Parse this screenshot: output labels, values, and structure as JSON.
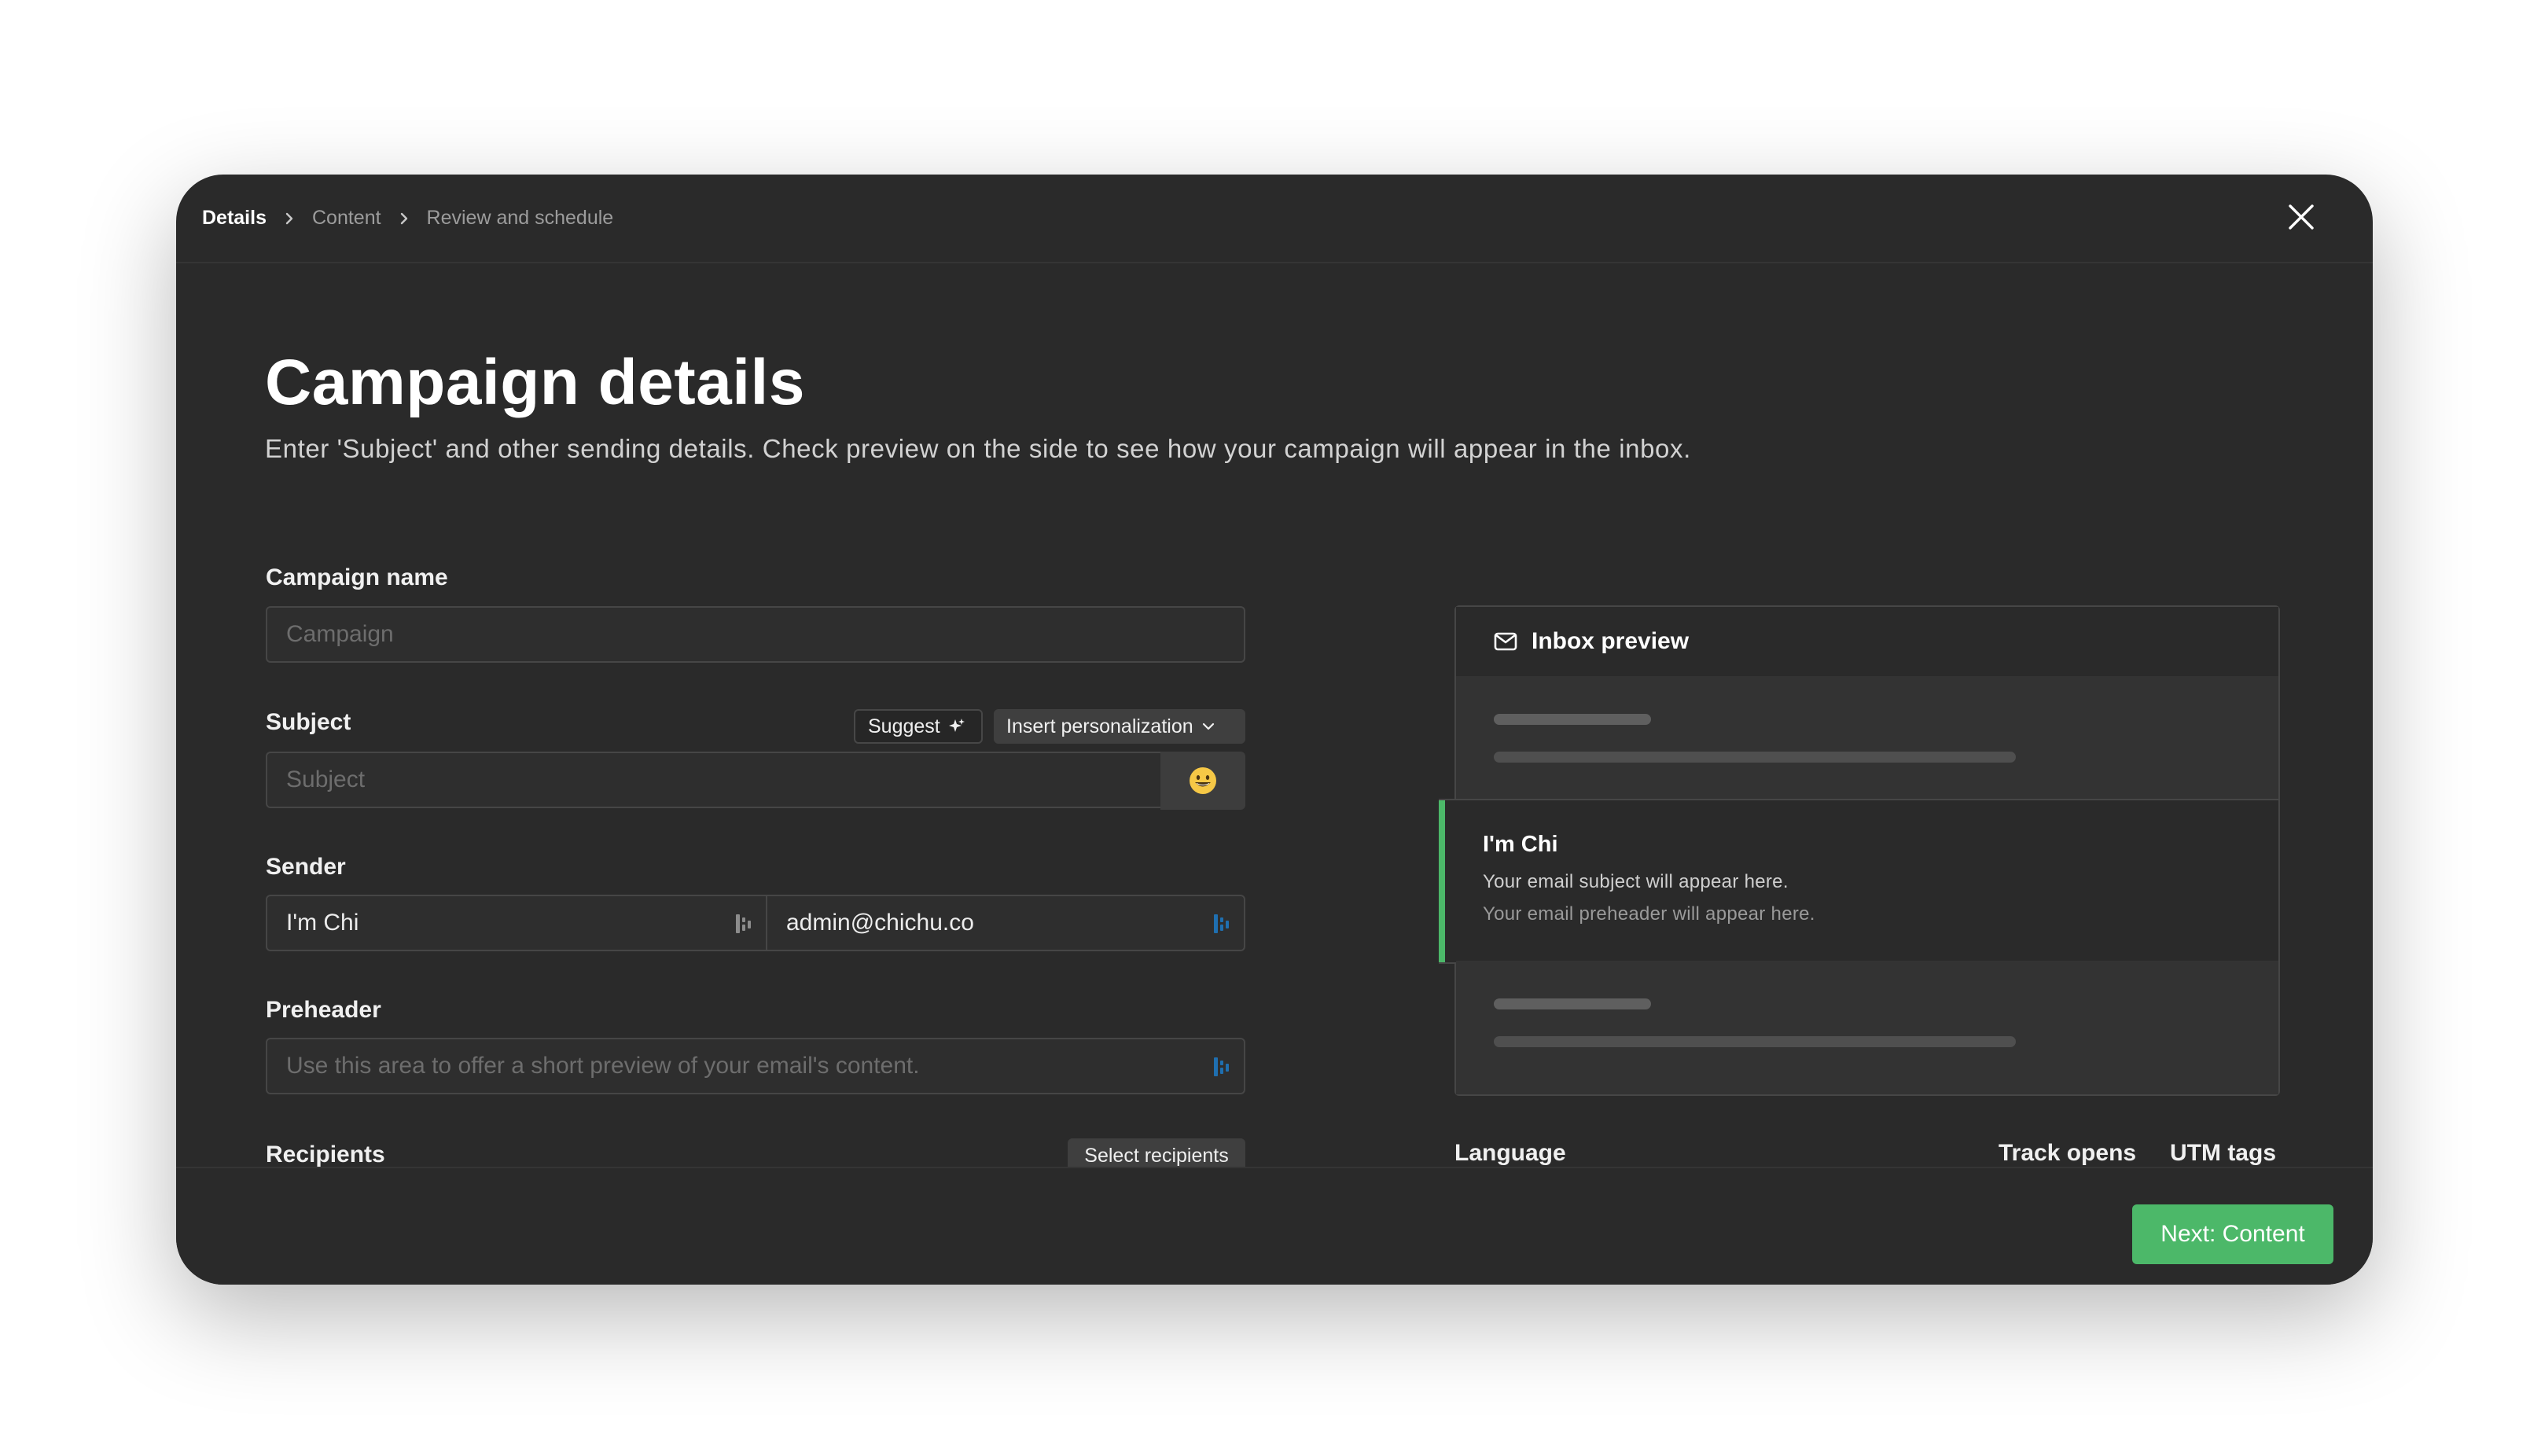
{
  "breadcrumb": {
    "items": [
      "Details",
      "Content",
      "Review and schedule"
    ]
  },
  "header": {
    "title": "Campaign details",
    "subtitle": "Enter 'Subject' and other sending details. Check preview on the side to see how your campaign will appear in the inbox."
  },
  "form": {
    "campaign_name": {
      "label": "Campaign name",
      "placeholder": "Campaign",
      "value": ""
    },
    "subject": {
      "label": "Subject",
      "placeholder": "Subject",
      "value": "",
      "suggest_label": "Suggest",
      "personalization_label": "Insert personalization",
      "emoji": "😀"
    },
    "sender": {
      "label": "Sender",
      "name": "I'm Chi",
      "email": "admin@chichu.co"
    },
    "preheader": {
      "label": "Preheader",
      "placeholder": "Use this area to offer a short preview of your email's content."
    },
    "recipients": {
      "label": "Recipients",
      "select_label": "Select recipients"
    },
    "language": {
      "label": "Language"
    },
    "track_opens": {
      "label": "Track opens"
    },
    "utm_tags": {
      "label": "UTM tags"
    }
  },
  "preview": {
    "title": "Inbox preview",
    "sender_name": "I'm Chi",
    "subject_placeholder": "Your email subject will appear here.",
    "preheader_placeholder": "Your email preheader will appear here."
  },
  "footer": {
    "next_label": "Next: Content"
  },
  "colors": {
    "accent": "#4cb869",
    "modal_bg": "#2a2a2a",
    "page_bg": "#ffffff",
    "ai_icon_blue": "#1f6fb0"
  }
}
